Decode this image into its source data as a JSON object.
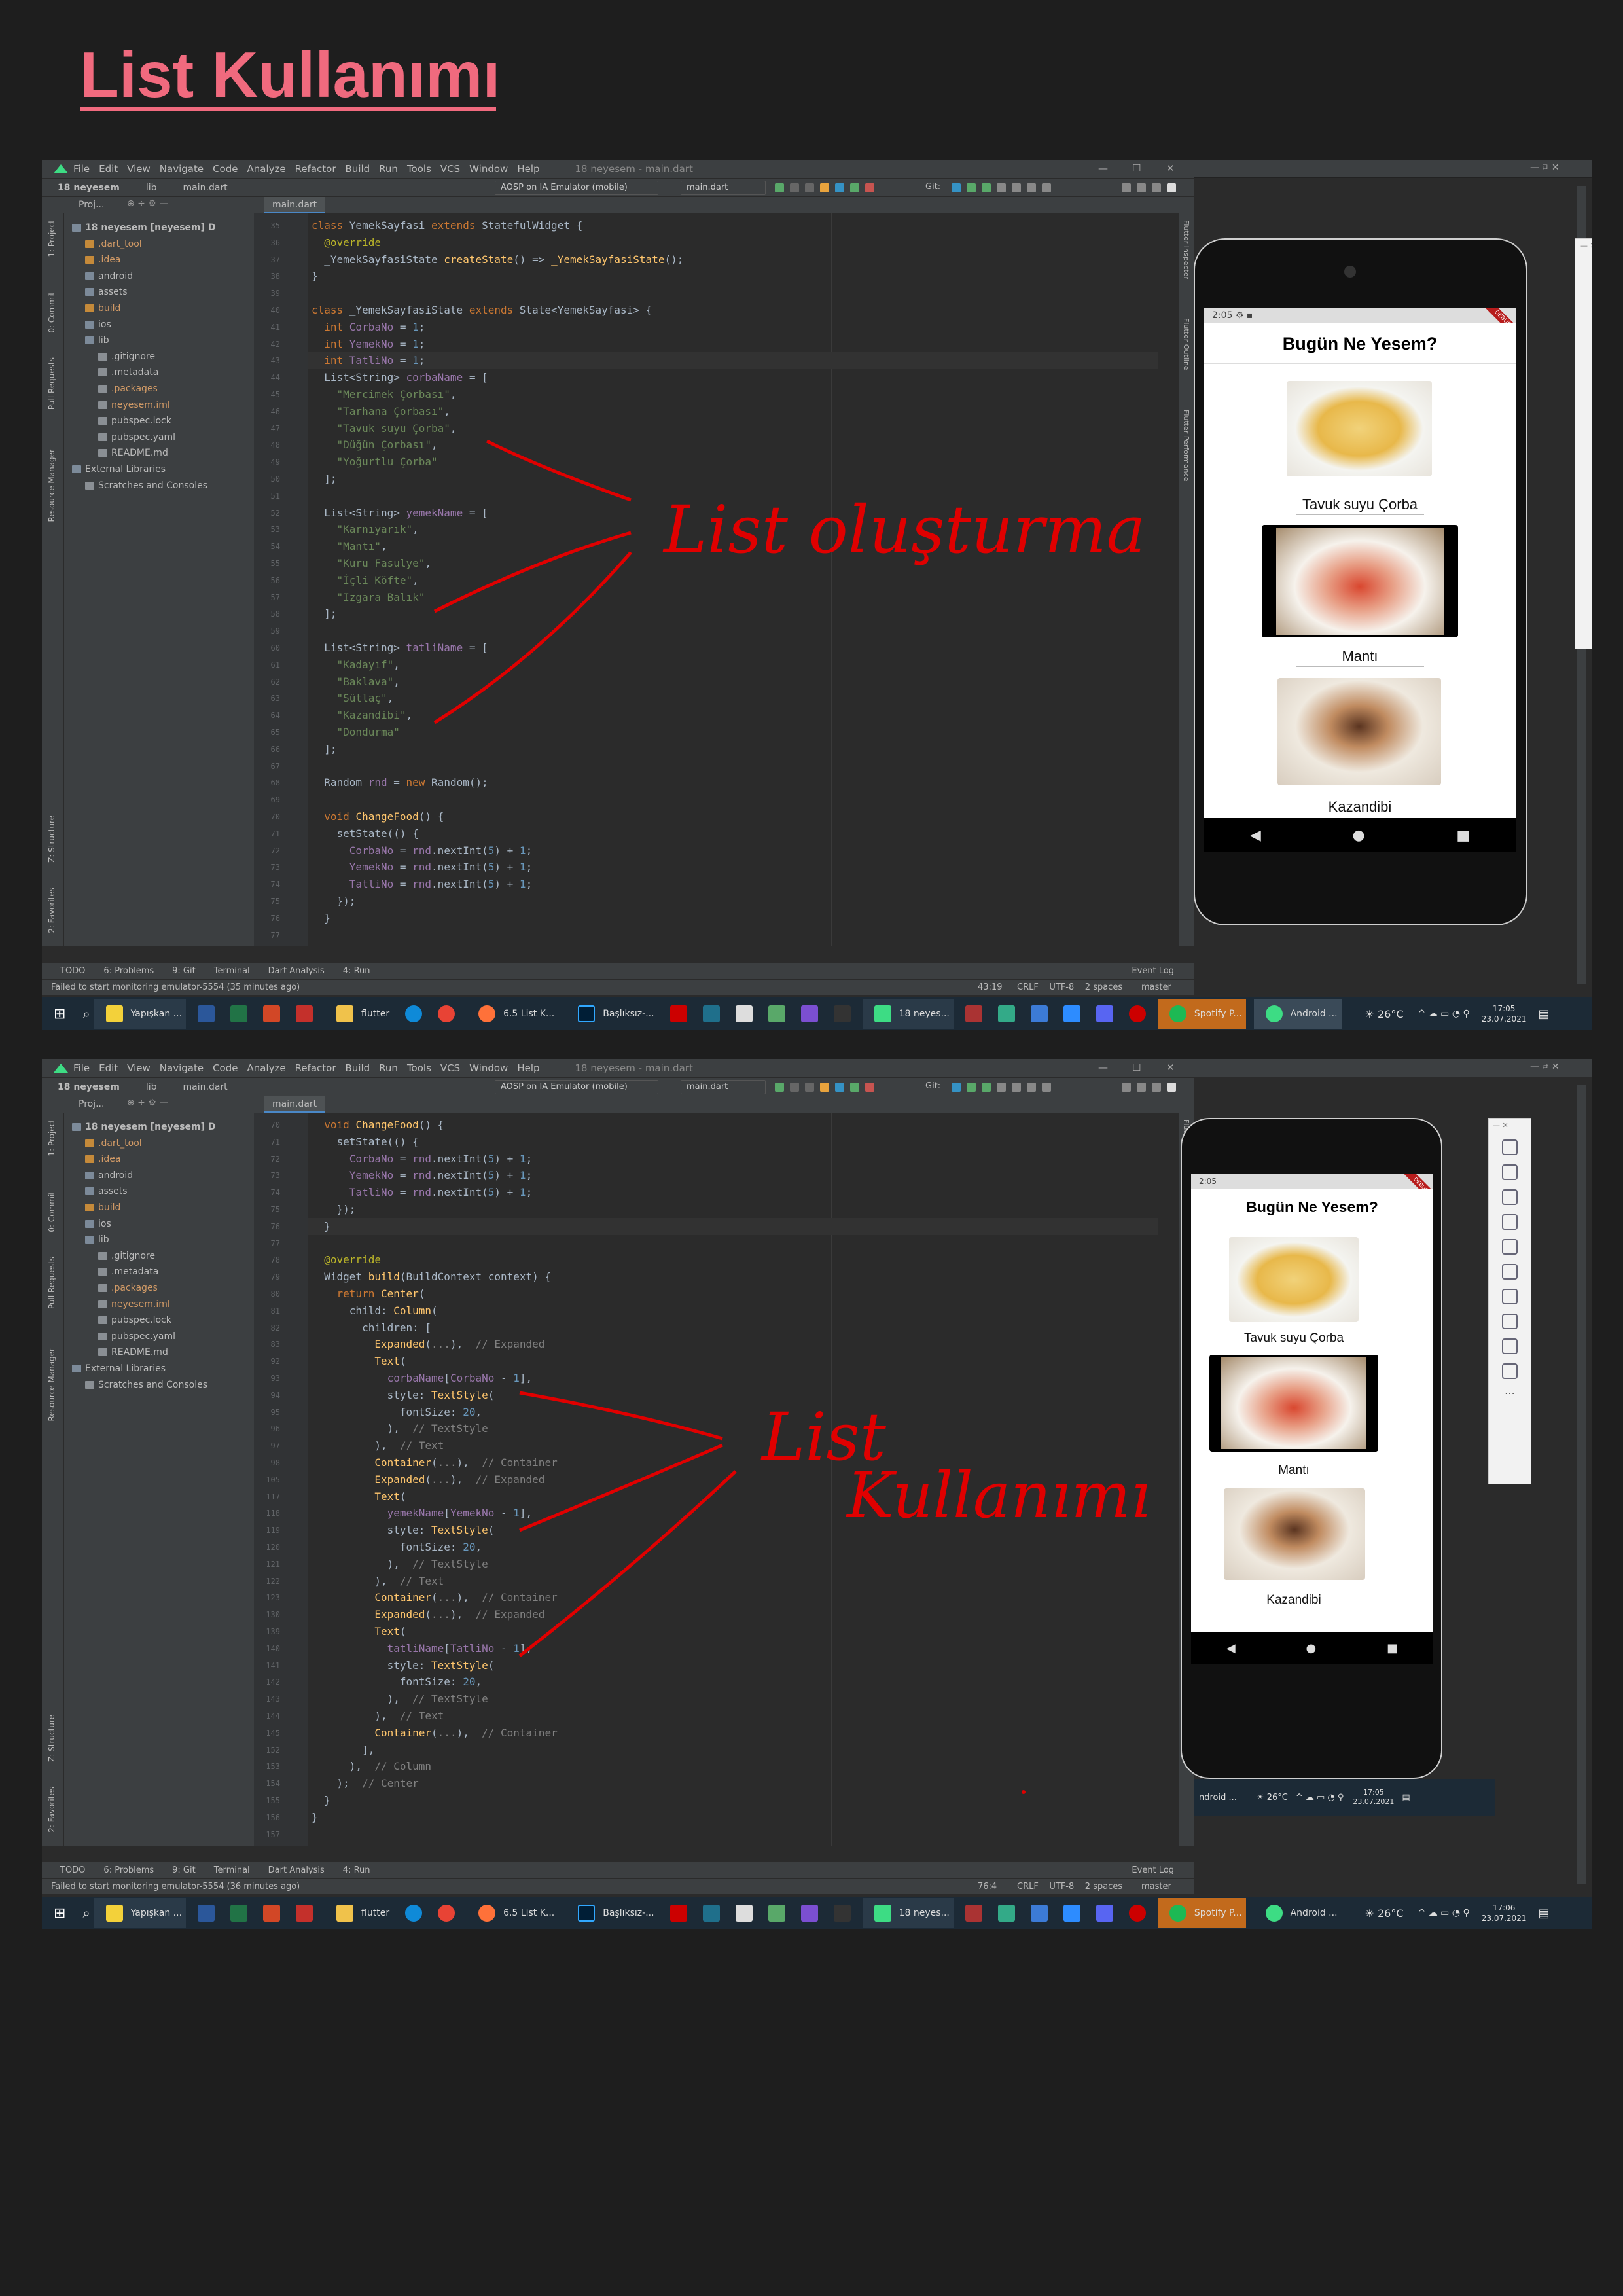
{
  "page_title": "List Kullanımı",
  "ide": {
    "menu": [
      "File",
      "Edit",
      "View",
      "Navigate",
      "Code",
      "Analyze",
      "Refactor",
      "Build",
      "Run",
      "Tools",
      "VCS",
      "Window",
      "Help"
    ],
    "window_title": "18 neyesem - main.dart",
    "breadcrumb_project": "18 neyesem",
    "breadcrumb_lib": "lib",
    "breadcrumb_file": "main.dart",
    "device_dropdown": "AOSP on IA Emulator (mobile)",
    "run_config": "main.dart",
    "git_label": "Git:",
    "editor_tab": "main.dart",
    "project_label": "Proj...",
    "tree": [
      {
        "label": "18 neyesem [neyesem]",
        "suffix": "D",
        "color": "#bbbbbb",
        "indent": 0
      },
      {
        "label": ".dart_tool",
        "color": "#d19a66",
        "indent": 1
      },
      {
        "label": ".idea",
        "color": "#d19a66",
        "indent": 1
      },
      {
        "label": "android",
        "color": "#bbbbbb",
        "indent": 1
      },
      {
        "label": "assets",
        "color": "#bbbbbb",
        "indent": 1
      },
      {
        "label": "build",
        "color": "#d19a66",
        "indent": 1
      },
      {
        "label": "ios",
        "color": "#bbbbbb",
        "indent": 1
      },
      {
        "label": "lib",
        "color": "#bbbbbb",
        "indent": 1
      },
      {
        "label": ".gitignore",
        "color": "#bbbbbb",
        "indent": 2
      },
      {
        "label": ".metadata",
        "color": "#bbbbbb",
        "indent": 2
      },
      {
        "label": ".packages",
        "color": "#d19a66",
        "indent": 2
      },
      {
        "label": "neyesem.iml",
        "color": "#d19a66",
        "indent": 2
      },
      {
        "label": "pubspec.lock",
        "color": "#bbbbbb",
        "indent": 2
      },
      {
        "label": "pubspec.yaml",
        "color": "#bbbbbb",
        "indent": 2
      },
      {
        "label": "README.md",
        "color": "#bbbbbb",
        "indent": 2
      },
      {
        "label": "External Libraries",
        "color": "#bbbbbb",
        "indent": 0
      },
      {
        "label": "Scratches and Consoles",
        "color": "#bbbbbb",
        "indent": 1
      }
    ],
    "left_tabs": [
      "1: Project",
      "0: Commit",
      "Pull Requests",
      "Resource Manager",
      "Z: Structure",
      "2: Favorites"
    ],
    "right_tabs": [
      "Flutter Inspector",
      "Flutter Outline",
      "Flutter Performance"
    ],
    "bottom_tabs": [
      "TODO",
      "6: Problems",
      "9: Git",
      "Terminal",
      "Dart Analysis",
      "4: Run"
    ],
    "event_log": "Event Log",
    "status_encoding": "CRLF    UTF-8    2 spaces",
    "status_branch": "master"
  },
  "shot1": {
    "status_msg": "Failed to start monitoring emulator-5554 (35 minutes ago)",
    "cursor_pos": "43:19",
    "lines": [
      {
        "n": "35",
        "html": "<span class='kw'>class </span>YemekSayfasi <span class='kw'>extends </span>StatefulWidget {"
      },
      {
        "n": "36",
        "html": "  <span class='an'>@override</span>"
      },
      {
        "n": "37",
        "html": "  _YemekSayfasiState <span class='fn'>createState</span>() => <span class='fn'>_YemekSayfasiState</span>();"
      },
      {
        "n": "38",
        "html": "}"
      },
      {
        "n": "39",
        "html": ""
      },
      {
        "n": "40",
        "html": "<span class='kw'>class </span>_YemekSayfasiState <span class='kw'>extends </span>State&lt;YemekSayfasi&gt; {"
      },
      {
        "n": "41",
        "html": "  <span class='kw'>int </span><span class='fd'>CorbaNo</span> = <span class='nm'>1</span>;"
      },
      {
        "n": "42",
        "html": "  <span class='kw'>int </span><span class='fd'>YemekNo</span> = <span class='nm'>1</span>;"
      },
      {
        "n": "43",
        "html": "  <span class='kw'>int </span><span class='fd'>TatliNo</span> = <span class='nm'>1</span>;"
      },
      {
        "n": "44",
        "html": "  List&lt;String&gt; <span class='fd'>corbaName</span> = ["
      },
      {
        "n": "45",
        "html": "    <span class='st'>\"Mercimek Çorbası\"</span>,"
      },
      {
        "n": "46",
        "html": "    <span class='st'>\"Tarhana Çorbası\"</span>,"
      },
      {
        "n": "47",
        "html": "    <span class='st'>\"Tavuk suyu Çorba\"</span>,"
      },
      {
        "n": "48",
        "html": "    <span class='st'>\"Düğün Çorbası\"</span>,"
      },
      {
        "n": "49",
        "html": "    <span class='st'>\"Yoğurtlu Çorba\"</span>"
      },
      {
        "n": "50",
        "html": "  ];"
      },
      {
        "n": "51",
        "html": ""
      },
      {
        "n": "52",
        "html": "  List&lt;String&gt; <span class='fd'>yemekName</span> = ["
      },
      {
        "n": "53",
        "html": "    <span class='st'>\"Karnıyarık\"</span>,"
      },
      {
        "n": "54",
        "html": "    <span class='st'>\"Mantı\"</span>,"
      },
      {
        "n": "55",
        "html": "    <span class='st'>\"Kuru Fasulye\"</span>,"
      },
      {
        "n": "56",
        "html": "    <span class='st'>\"İçli Köfte\"</span>,"
      },
      {
        "n": "57",
        "html": "    <span class='st'>\"Izgara Balık\"</span>"
      },
      {
        "n": "58",
        "html": "  ];"
      },
      {
        "n": "59",
        "html": ""
      },
      {
        "n": "60",
        "html": "  List&lt;String&gt; <span class='fd'>tatliName</span> = ["
      },
      {
        "n": "61",
        "html": "    <span class='st'>\"Kadayıf\"</span>,"
      },
      {
        "n": "62",
        "html": "    <span class='st'>\"Baklava\"</span>,"
      },
      {
        "n": "63",
        "html": "    <span class='st'>\"Sütlaç\"</span>,"
      },
      {
        "n": "64",
        "html": "    <span class='st'>\"Kazandibi\"</span>,"
      },
      {
        "n": "65",
        "html": "    <span class='st'>\"Dondurma\"</span>"
      },
      {
        "n": "66",
        "html": "  ];"
      },
      {
        "n": "67",
        "html": ""
      },
      {
        "n": "68",
        "html": "  Random <span class='fd'>rnd</span> = <span class='kw'>new </span>Random();"
      },
      {
        "n": "69",
        "html": ""
      },
      {
        "n": "70",
        "html": "  <span class='kw'>void </span><span class='fn'>ChangeFood</span>() {"
      },
      {
        "n": "71",
        "html": "    setState(() {"
      },
      {
        "n": "72",
        "html": "      <span class='fd'>CorbaNo</span> = <span class='fd'>rnd</span>.nextInt(<span class='nm'>5</span>) + <span class='nm'>1</span>;"
      },
      {
        "n": "73",
        "html": "      <span class='fd'>YemekNo</span> = <span class='fd'>rnd</span>.nextInt(<span class='nm'>5</span>) + <span class='nm'>1</span>;"
      },
      {
        "n": "74",
        "html": "      <span class='fd'>TatliNo</span> = <span class='fd'>rnd</span>.nextInt(<span class='nm'>5</span>) + <span class='nm'>1</span>;"
      },
      {
        "n": "75",
        "html": "    });"
      },
      {
        "n": "76",
        "html": "  }"
      },
      {
        "n": "77",
        "html": ""
      }
    ],
    "annotation": "List oluşturma",
    "time": "17:05",
    "date": "23.07.2021",
    "temp": "26°C"
  },
  "shot2": {
    "status_msg": "Failed to start monitoring emulator-5554 (36 minutes ago)",
    "cursor_pos": "76:4",
    "lines": [
      {
        "n": "70",
        "html": "  <span class='kw'>void </span><span class='fn'>ChangeFood</span>() {"
      },
      {
        "n": "71",
        "html": "    setState(() {"
      },
      {
        "n": "72",
        "html": "      <span class='fd'>CorbaNo</span> = <span class='fd'>rnd</span>.nextInt(<span class='nm'>5</span>) + <span class='nm'>1</span>;"
      },
      {
        "n": "73",
        "html": "      <span class='fd'>YemekNo</span> = <span class='fd'>rnd</span>.nextInt(<span class='nm'>5</span>) + <span class='nm'>1</span>;"
      },
      {
        "n": "74",
        "html": "      <span class='fd'>TatliNo</span> = <span class='fd'>rnd</span>.nextInt(<span class='nm'>5</span>) + <span class='nm'>1</span>;"
      },
      {
        "n": "75",
        "html": "    });"
      },
      {
        "n": "76",
        "html": "  }"
      },
      {
        "n": "77",
        "html": ""
      },
      {
        "n": "78",
        "html": "  <span class='an'>@override</span>"
      },
      {
        "n": "79",
        "html": "  Widget <span class='fn'>build</span>(BuildContext context) {"
      },
      {
        "n": "80",
        "html": "    <span class='kw'>return </span><span class='fn'>Center</span>("
      },
      {
        "n": "81",
        "html": "      child: <span class='fn'>Column</span>("
      },
      {
        "n": "82",
        "html": "        children: ["
      },
      {
        "n": "83",
        "html": "          <span class='fn'>Expanded</span>(<span class='cm'>...</span>),  <span class='cm'>// Expanded</span>"
      },
      {
        "n": "92",
        "html": "          <span class='fn'>Text</span>("
      },
      {
        "n": "93",
        "html": "            <span class='fd'>corbaName</span>[<span class='fd'>CorbaNo</span> - <span class='nm'>1</span>],"
      },
      {
        "n": "94",
        "html": "            style: <span class='fn'>TextStyle</span>("
      },
      {
        "n": "95",
        "html": "              fontSize: <span class='nm'>20</span>,"
      },
      {
        "n": "96",
        "html": "            ),  <span class='cm'>// TextStyle</span>"
      },
      {
        "n": "97",
        "html": "          ),  <span class='cm'>// Text</span>"
      },
      {
        "n": "98",
        "html": "          <span class='fn'>Container</span>(<span class='cm'>...</span>),  <span class='cm'>// Container</span>"
      },
      {
        "n": "105",
        "html": "          <span class='fn'>Expanded</span>(<span class='cm'>...</span>),  <span class='cm'>// Expanded</span>"
      },
      {
        "n": "117",
        "html": "          <span class='fn'>Text</span>("
      },
      {
        "n": "118",
        "html": "            <span class='fd'>yemekName</span>[<span class='fd'>YemekNo</span> - <span class='nm'>1</span>],"
      },
      {
        "n": "119",
        "html": "            style: <span class='fn'>TextStyle</span>("
      },
      {
        "n": "120",
        "html": "              fontSize: <span class='nm'>20</span>,"
      },
      {
        "n": "121",
        "html": "            ),  <span class='cm'>// TextStyle</span>"
      },
      {
        "n": "122",
        "html": "          ),  <span class='cm'>// Text</span>"
      },
      {
        "n": "123",
        "html": "          <span class='fn'>Container</span>(<span class='cm'>...</span>),  <span class='cm'>// Container</span>"
      },
      {
        "n": "130",
        "html": "          <span class='fn'>Expanded</span>(<span class='cm'>...</span>),  <span class='cm'>// Expanded</span>"
      },
      {
        "n": "139",
        "html": "          <span class='fn'>Text</span>("
      },
      {
        "n": "140",
        "html": "            <span class='fd'>tatliName</span>[<span class='fd'>TatliNo</span> - <span class='nm'>1</span>],"
      },
      {
        "n": "141",
        "html": "            style: <span class='fn'>TextStyle</span>("
      },
      {
        "n": "142",
        "html": "              fontSize: <span class='nm'>20</span>,"
      },
      {
        "n": "143",
        "html": "            ),  <span class='cm'>// TextStyle</span>"
      },
      {
        "n": "144",
        "html": "          ),  <span class='cm'>// Text</span>"
      },
      {
        "n": "145",
        "html": "          <span class='fn'>Container</span>(<span class='cm'>...</span>),  <span class='cm'>// Container</span>"
      },
      {
        "n": "152",
        "html": "        ],"
      },
      {
        "n": "153",
        "html": "      ),  <span class='cm'>// Column</span>"
      },
      {
        "n": "154",
        "html": "    );  <span class='cm'>// Center</span>"
      },
      {
        "n": "155",
        "html": "  }"
      },
      {
        "n": "156",
        "html": "}"
      },
      {
        "n": "157",
        "html": ""
      }
    ],
    "annotation_line1": "List",
    "annotation_line2": "Kullanımı",
    "time": "17:06",
    "date": "23.07.2021",
    "temp": "26°C",
    "emu_time": "17:05",
    "emu_date": "23.07.2021"
  },
  "app": {
    "title": "Bugün Ne Yesem?",
    "status_time": "2:05",
    "soup": "Tavuk suyu Çorba",
    "main": "Mantı",
    "dessert": "Kazandibi",
    "debug_ribbon": "DEBUG"
  },
  "taskbar": {
    "apps": [
      "Yapışkan ...",
      "flutter",
      "6.5 List K...",
      "Başlıksız-...",
      "18 neyes...",
      "Spotify P...",
      "Android ..."
    ]
  }
}
